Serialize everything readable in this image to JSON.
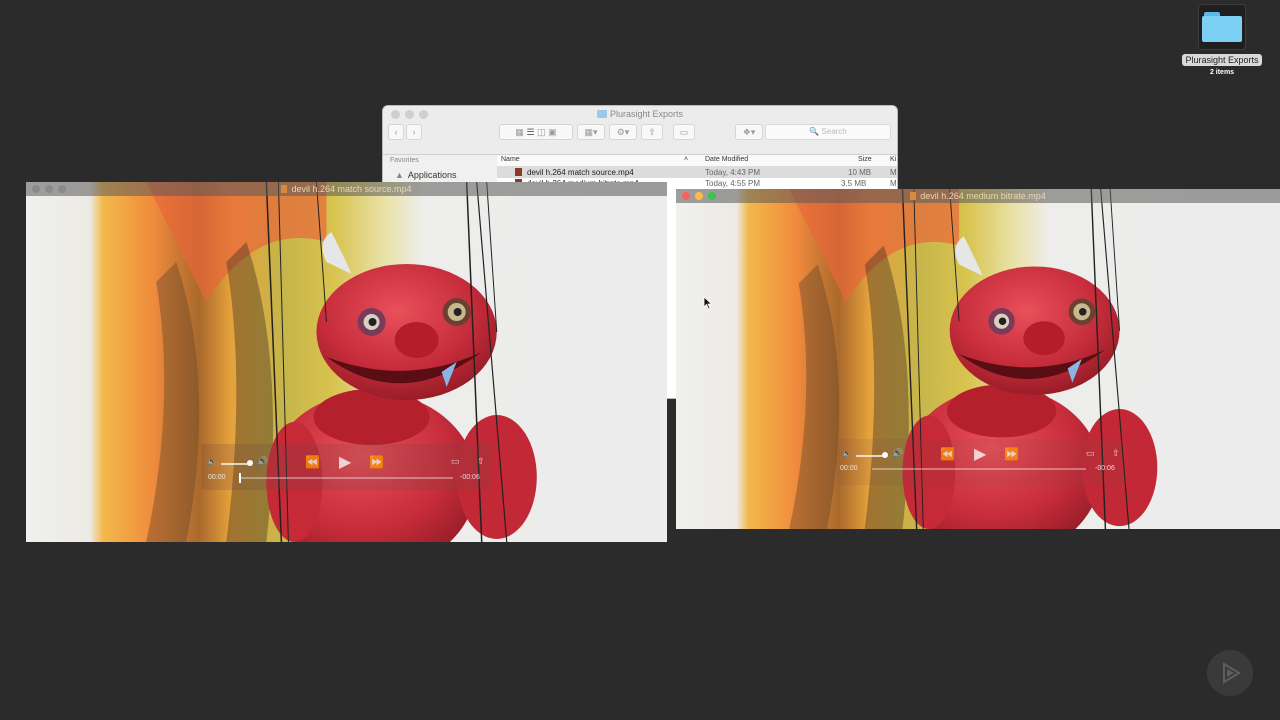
{
  "desktop": {
    "folder": {
      "name": "Plurasight Exports",
      "items": "2 items",
      "icon": "folder-icon"
    }
  },
  "finder": {
    "title": "Plurasight Exports",
    "search_placeholder": "Search",
    "sidebar": {
      "heading": "Favorites",
      "items": [
        {
          "label": "Applications",
          "icon": "applications-icon"
        }
      ]
    },
    "columns": {
      "name": "Name",
      "date": "Date Modified",
      "size": "Size",
      "kind": "Ki"
    },
    "files": [
      {
        "name": "devil h.264 match source.mp4",
        "date": "Today, 4:43 PM",
        "size": "10 MB",
        "kind": "M"
      },
      {
        "name": "devil h.264 medium bitrate.mp4",
        "date": "Today, 4:55 PM",
        "size": "3.5 MB",
        "kind": "M"
      }
    ]
  },
  "player_left": {
    "title": "devil h.264 match source.mp4",
    "time_elapsed": "00:00",
    "time_remaining": "-00:06"
  },
  "player_right": {
    "title": "devil h.264 medium bitrate.mp4",
    "time_elapsed": "00:00",
    "time_remaining": "-00:06"
  },
  "colors": {
    "desktop": "#2b2b2b",
    "folder": "#7cd0f4",
    "close": "#fc605b",
    "minimize": "#fdbc40",
    "zoom": "#34c84a"
  }
}
